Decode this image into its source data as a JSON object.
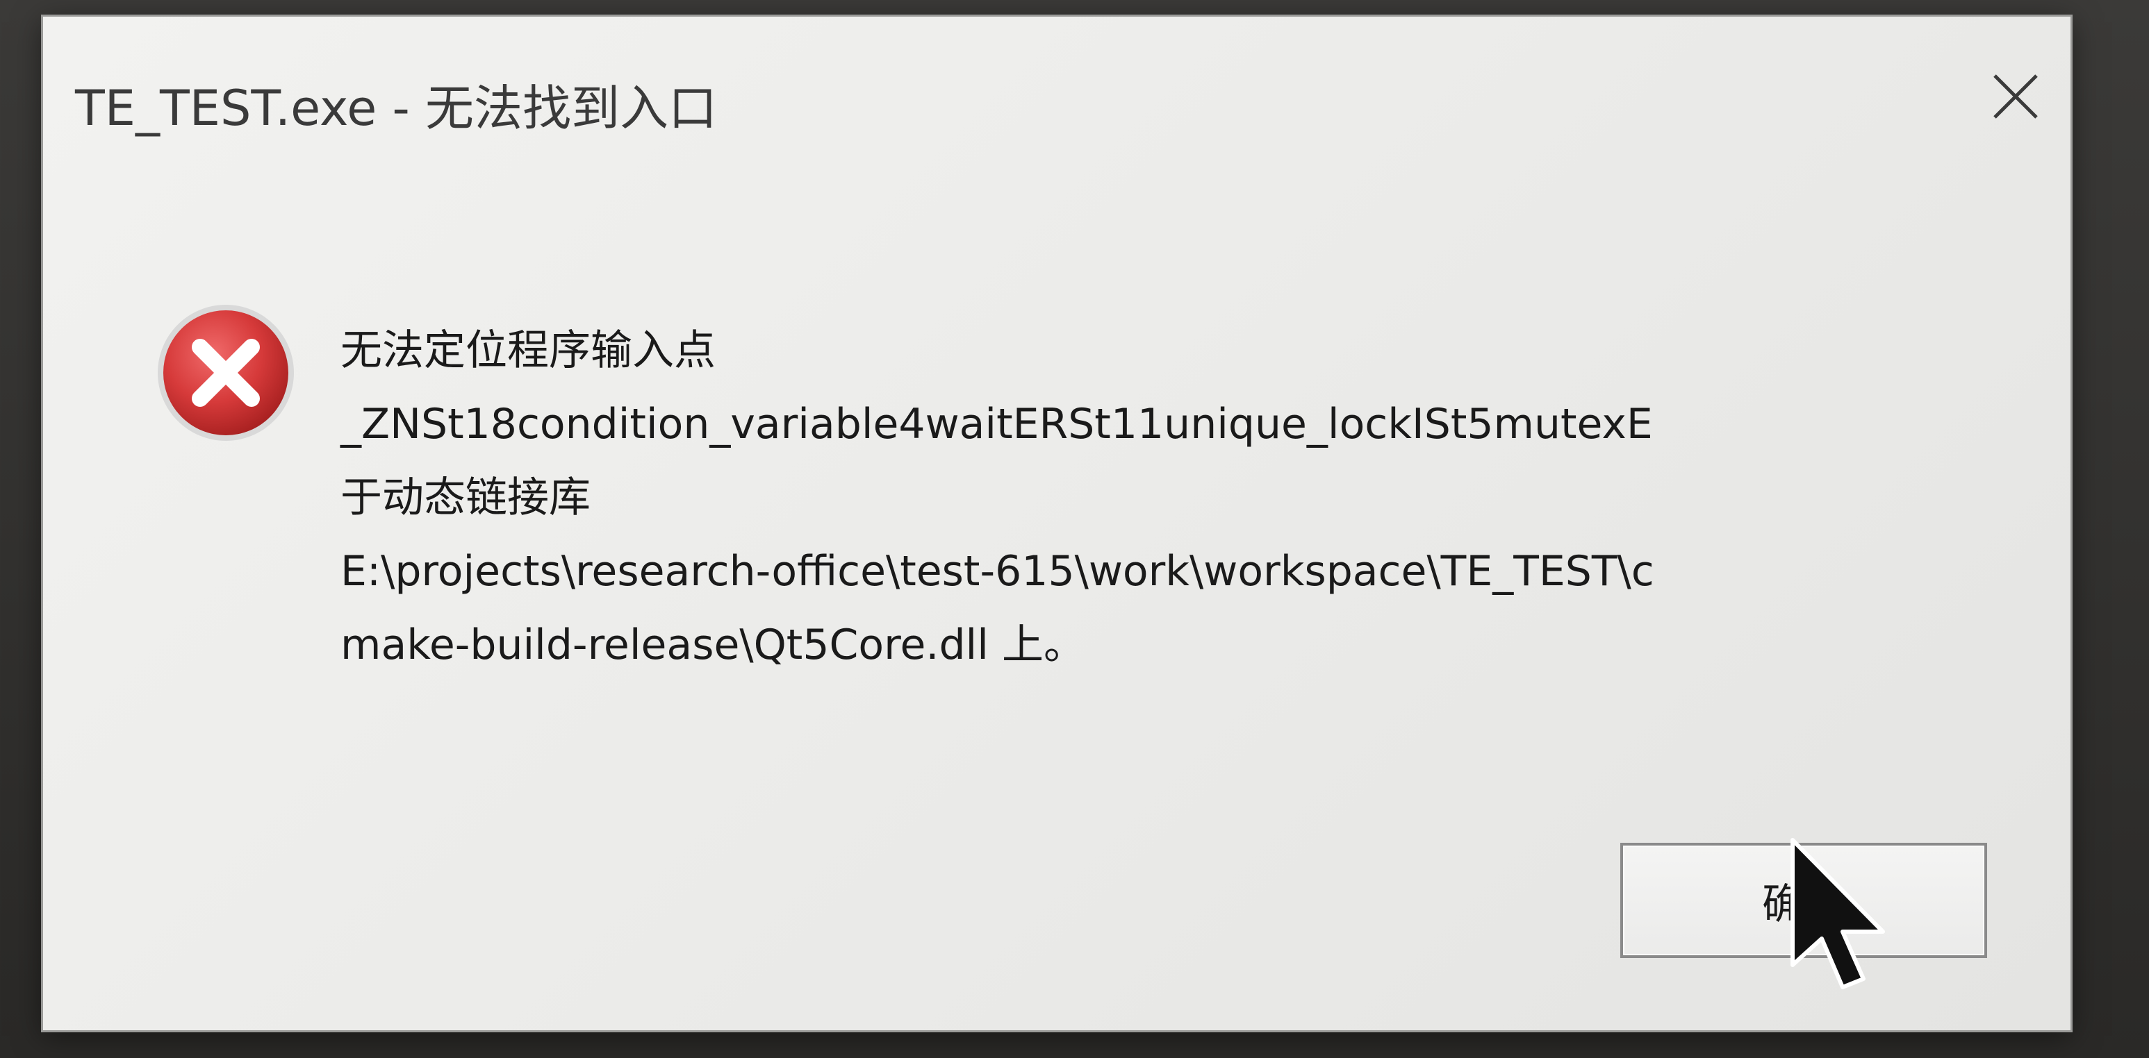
{
  "window": {
    "title": "TE_TEST.exe - 无法找到入口"
  },
  "icons": {
    "close": "close-icon",
    "error": "error-icon",
    "cursor": "mouse-pointer-icon"
  },
  "message": {
    "lines": [
      "无法定位程序输入点",
      "_ZNSt18condition_variable4waitERSt11unique_lockISt5mutexE",
      "于动态链接库",
      "E:\\projects\\research-office\\test-615\\work\\workspace\\TE_TEST\\c",
      "make-build-release\\Qt5Core.dll 上。"
    ]
  },
  "buttons": {
    "ok_label": "确定"
  },
  "colors": {
    "error_red": "#d63a3a",
    "dialog_bg": "#efefed",
    "button_border": "#8a8a8a"
  }
}
